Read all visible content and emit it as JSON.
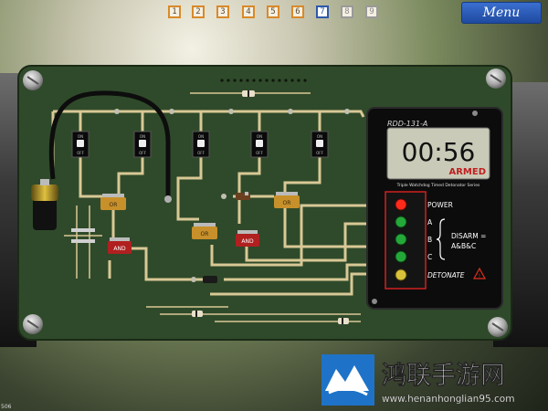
{
  "level_nav": {
    "levels": [
      {
        "label": "1",
        "state": "done"
      },
      {
        "label": "2",
        "state": "done"
      },
      {
        "label": "3",
        "state": "done"
      },
      {
        "label": "4",
        "state": "done"
      },
      {
        "label": "5",
        "state": "done"
      },
      {
        "label": "6",
        "state": "done"
      },
      {
        "label": "7",
        "state": "current"
      },
      {
        "label": "8",
        "state": "locked"
      },
      {
        "label": "9",
        "state": "locked"
      }
    ]
  },
  "menu_button": {
    "label": "Menu"
  },
  "board": {
    "switches": [
      {
        "on": "ON",
        "off": "OFF"
      },
      {
        "on": "ON",
        "off": "OFF"
      },
      {
        "on": "ON",
        "off": "OFF"
      },
      {
        "on": "ON",
        "off": "OFF"
      },
      {
        "on": "ON",
        "off": "OFF"
      }
    ],
    "or_gates": [
      "OR",
      "OR",
      "OR",
      "OR"
    ],
    "and_gates": [
      "AND",
      "AND"
    ]
  },
  "detonator": {
    "model": "RDD-131-A",
    "timer": "00:56",
    "status": "ARMED",
    "series": "Triple Watchdog Timed Detonator Series",
    "rows": [
      {
        "label": "POWER",
        "led": "red"
      },
      {
        "label": "A",
        "led": "green"
      },
      {
        "label": "B",
        "led": "green"
      },
      {
        "label": "C",
        "led": "green"
      },
      {
        "label": "DETONATE",
        "led": "yellow"
      }
    ],
    "disarm_text": "DISARM =",
    "disarm_formula": "A&B&C"
  },
  "watermark": {
    "title": "鸿联手游网",
    "url": "www.henanhonglian95.com"
  },
  "fps_counter": "506",
  "colors": {
    "board": "#2f4a2a",
    "trace": "#d8c896",
    "led_red": "#ff2a1a",
    "led_green": "#24a83a",
    "led_yellow": "#d8c23a",
    "accent": "#d88a2a"
  }
}
